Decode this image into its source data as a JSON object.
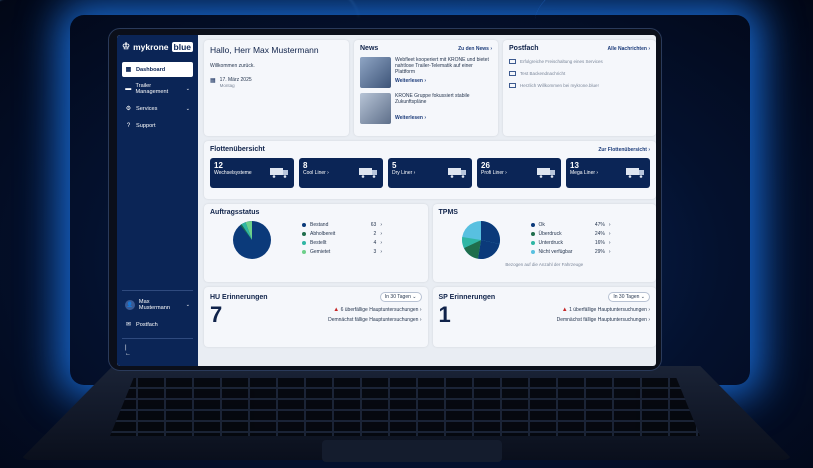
{
  "app": {
    "logo_left": "mykrone",
    "logo_right": "blue"
  },
  "sidebar": {
    "items": [
      {
        "label": "Dashboard",
        "icon": "dashboard-icon",
        "active": true
      },
      {
        "label": "Trailer Management",
        "icon": "truck-icon",
        "chevron": true
      },
      {
        "label": "Services",
        "icon": "gear-icon",
        "chevron": true
      },
      {
        "label": "Support",
        "icon": "help-icon"
      }
    ],
    "user": "Max Mustermann",
    "postfach": "Postfach"
  },
  "welcome": {
    "title": "Hallo, Herr Max Mustermann",
    "subtitle": "Willkommen zurück.",
    "date": "17. März 2025",
    "weekday": "Montag"
  },
  "news": {
    "title": "News",
    "all_link": "Zu den News",
    "items": [
      {
        "text": "Webfleet kooperiert mit KRONE und bietet nahtlose Trailer-Telematik auf einer Plattform",
        "more": "Weiterlesen"
      },
      {
        "text": "KRONE Gruppe fokussiert stabile Zukunftspläne",
        "more": "Weiterlesen"
      }
    ]
  },
  "mailbox": {
    "title": "Postfach",
    "all_link": "Alle Nachrichten",
    "items": [
      "Erfolgreiche Freischaltung eines Services",
      "Test Backendnachricht",
      "Herzlich Willkommen bei mykrone.blue!"
    ]
  },
  "fleet": {
    "title": "Flottenübersicht",
    "link": "Zur Flottenübersicht",
    "items": [
      {
        "count": "12",
        "label": "Wechselsysteme"
      },
      {
        "count": "8",
        "label": "Cool Liner"
      },
      {
        "count": "5",
        "label": "Dry Liner"
      },
      {
        "count": "26",
        "label": "Profi Liner"
      },
      {
        "count": "13",
        "label": "Mega Liner"
      }
    ]
  },
  "orders": {
    "title": "Auftragsstatus",
    "legend": [
      {
        "label": "Bestand",
        "value": "63",
        "color": "#0b3a7a"
      },
      {
        "label": "Abholbereit",
        "value": "2",
        "color": "#1f6e4c"
      },
      {
        "label": "Bestellt",
        "value": "4",
        "color": "#2fb6a4"
      },
      {
        "label": "Gemietet",
        "value": "3",
        "color": "#6dd08a"
      }
    ]
  },
  "tpms": {
    "title": "TPMS",
    "footnote": "Bezogen auf die Anzahl der Fahrzeuge",
    "legend": [
      {
        "label": "Ok",
        "value": "47%",
        "color": "#0b3a7a"
      },
      {
        "label": "Überdruck",
        "value": "24%",
        "color": "#1f6e4c"
      },
      {
        "label": "Unterdruck",
        "value": "16%",
        "color": "#2fb6a4"
      },
      {
        "label": "Nicht verfügbar",
        "value": "29%",
        "color": "#58c0e0"
      }
    ]
  },
  "hu": {
    "title": "HU Erinnerungen",
    "select": "In 30 Tagen",
    "count": "7",
    "overdue": "6 überfällige Hauptuntersuchungen",
    "soon": "Demnächst fällige Hauptuntersuchungen"
  },
  "sp": {
    "title": "SP Erinnerungen",
    "select": "In 30 Tagen",
    "count": "1",
    "overdue": "1 überfällige Hauptuntersuchungen",
    "soon": "Demnächst fällige Hauptuntersuchungen"
  }
}
